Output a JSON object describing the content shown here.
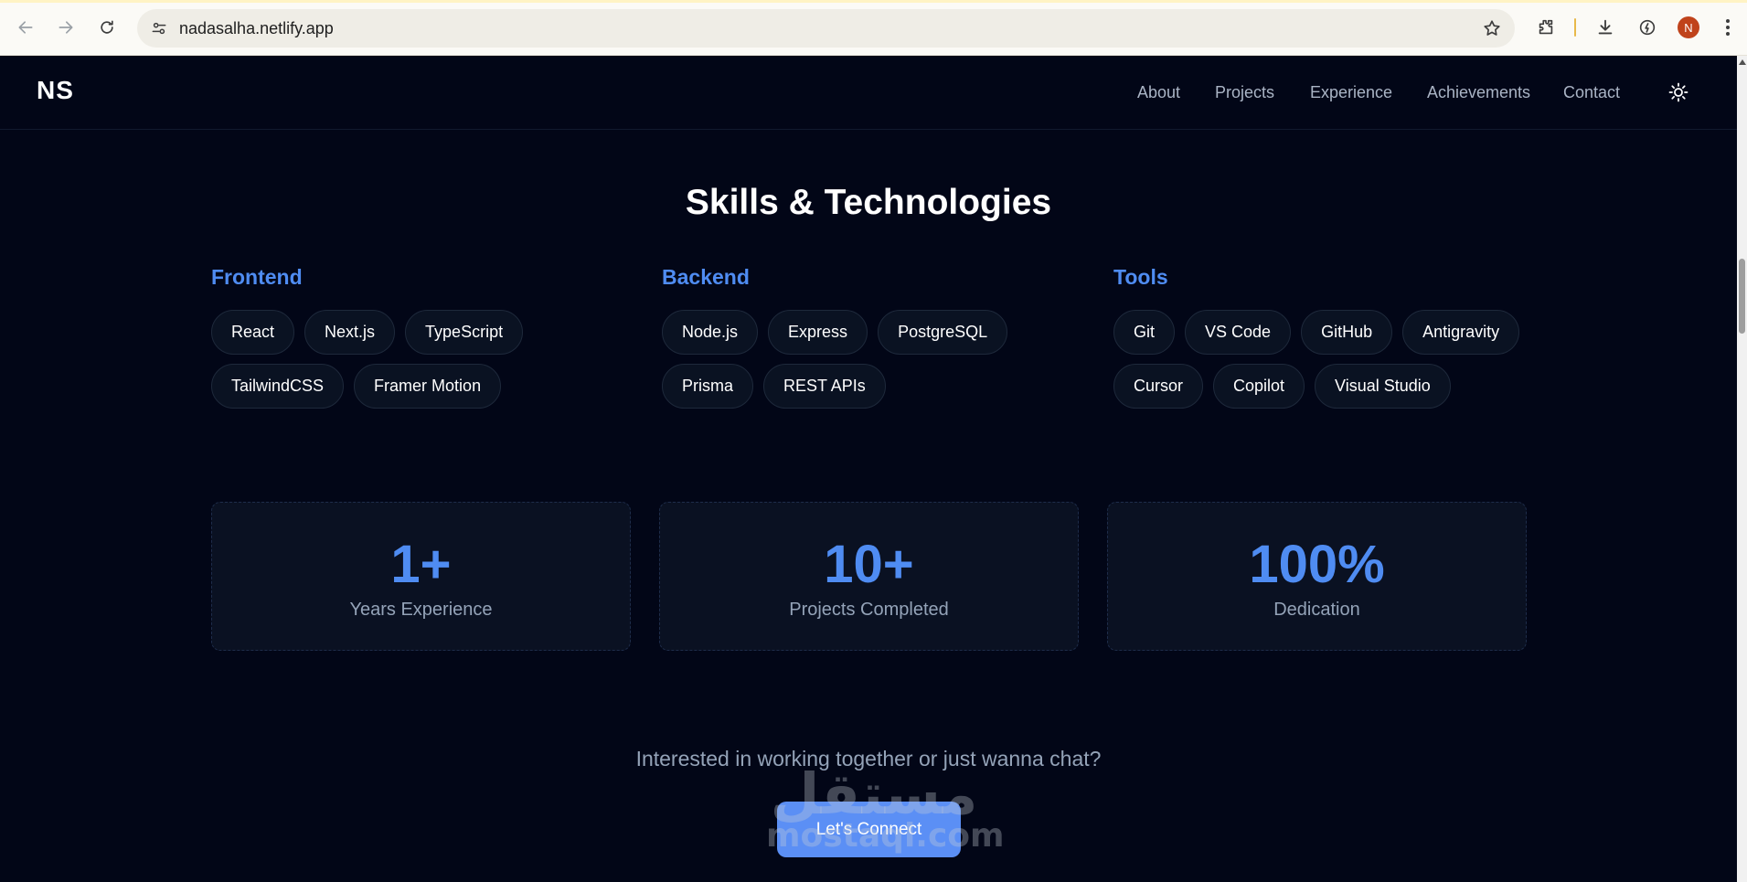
{
  "browser": {
    "url": "nadasalha.netlify.app",
    "profile_initial": "N",
    "icons": {
      "back": "arrow-left-icon",
      "forward": "arrow-right-icon",
      "reload": "reload-icon",
      "site_info": "tune-icon",
      "bookmark": "star-icon",
      "extensions": "puzzle-icon",
      "downloads": "download-icon",
      "performance": "gauge-icon",
      "menu": "kebab-icon"
    }
  },
  "header": {
    "logo": "NS",
    "nav": [
      "About",
      "Projects",
      "Experience",
      "Achievements",
      "Contact"
    ],
    "theme_icon": "sun-icon"
  },
  "skills": {
    "title": "Skills & Technologies",
    "categories": [
      {
        "name": "Frontend",
        "items": [
          "React",
          "Next.js",
          "TypeScript",
          "TailwindCSS",
          "Framer Motion"
        ]
      },
      {
        "name": "Backend",
        "items": [
          "Node.js",
          "Express",
          "PostgreSQL",
          "Prisma",
          "REST APIs"
        ]
      },
      {
        "name": "Tools",
        "items": [
          "Git",
          "VS Code",
          "GitHub",
          "Antigravity",
          "Cursor",
          "Copilot",
          "Visual Studio"
        ]
      }
    ]
  },
  "stats": [
    {
      "value": "1+",
      "label": "Years Experience"
    },
    {
      "value": "10+",
      "label": "Projects Completed"
    },
    {
      "value": "100%",
      "label": "Dedication"
    }
  ],
  "cta": {
    "text": "Interested in working together or just wanna chat?",
    "button": "Let's Connect"
  },
  "watermark": {
    "arabic": "مستقل",
    "latin": "mostaql.com"
  },
  "colors": {
    "accent": "#4f8cf2",
    "button": "#5b8ff5",
    "background": "#020617",
    "muted_text": "#94a3b8"
  }
}
